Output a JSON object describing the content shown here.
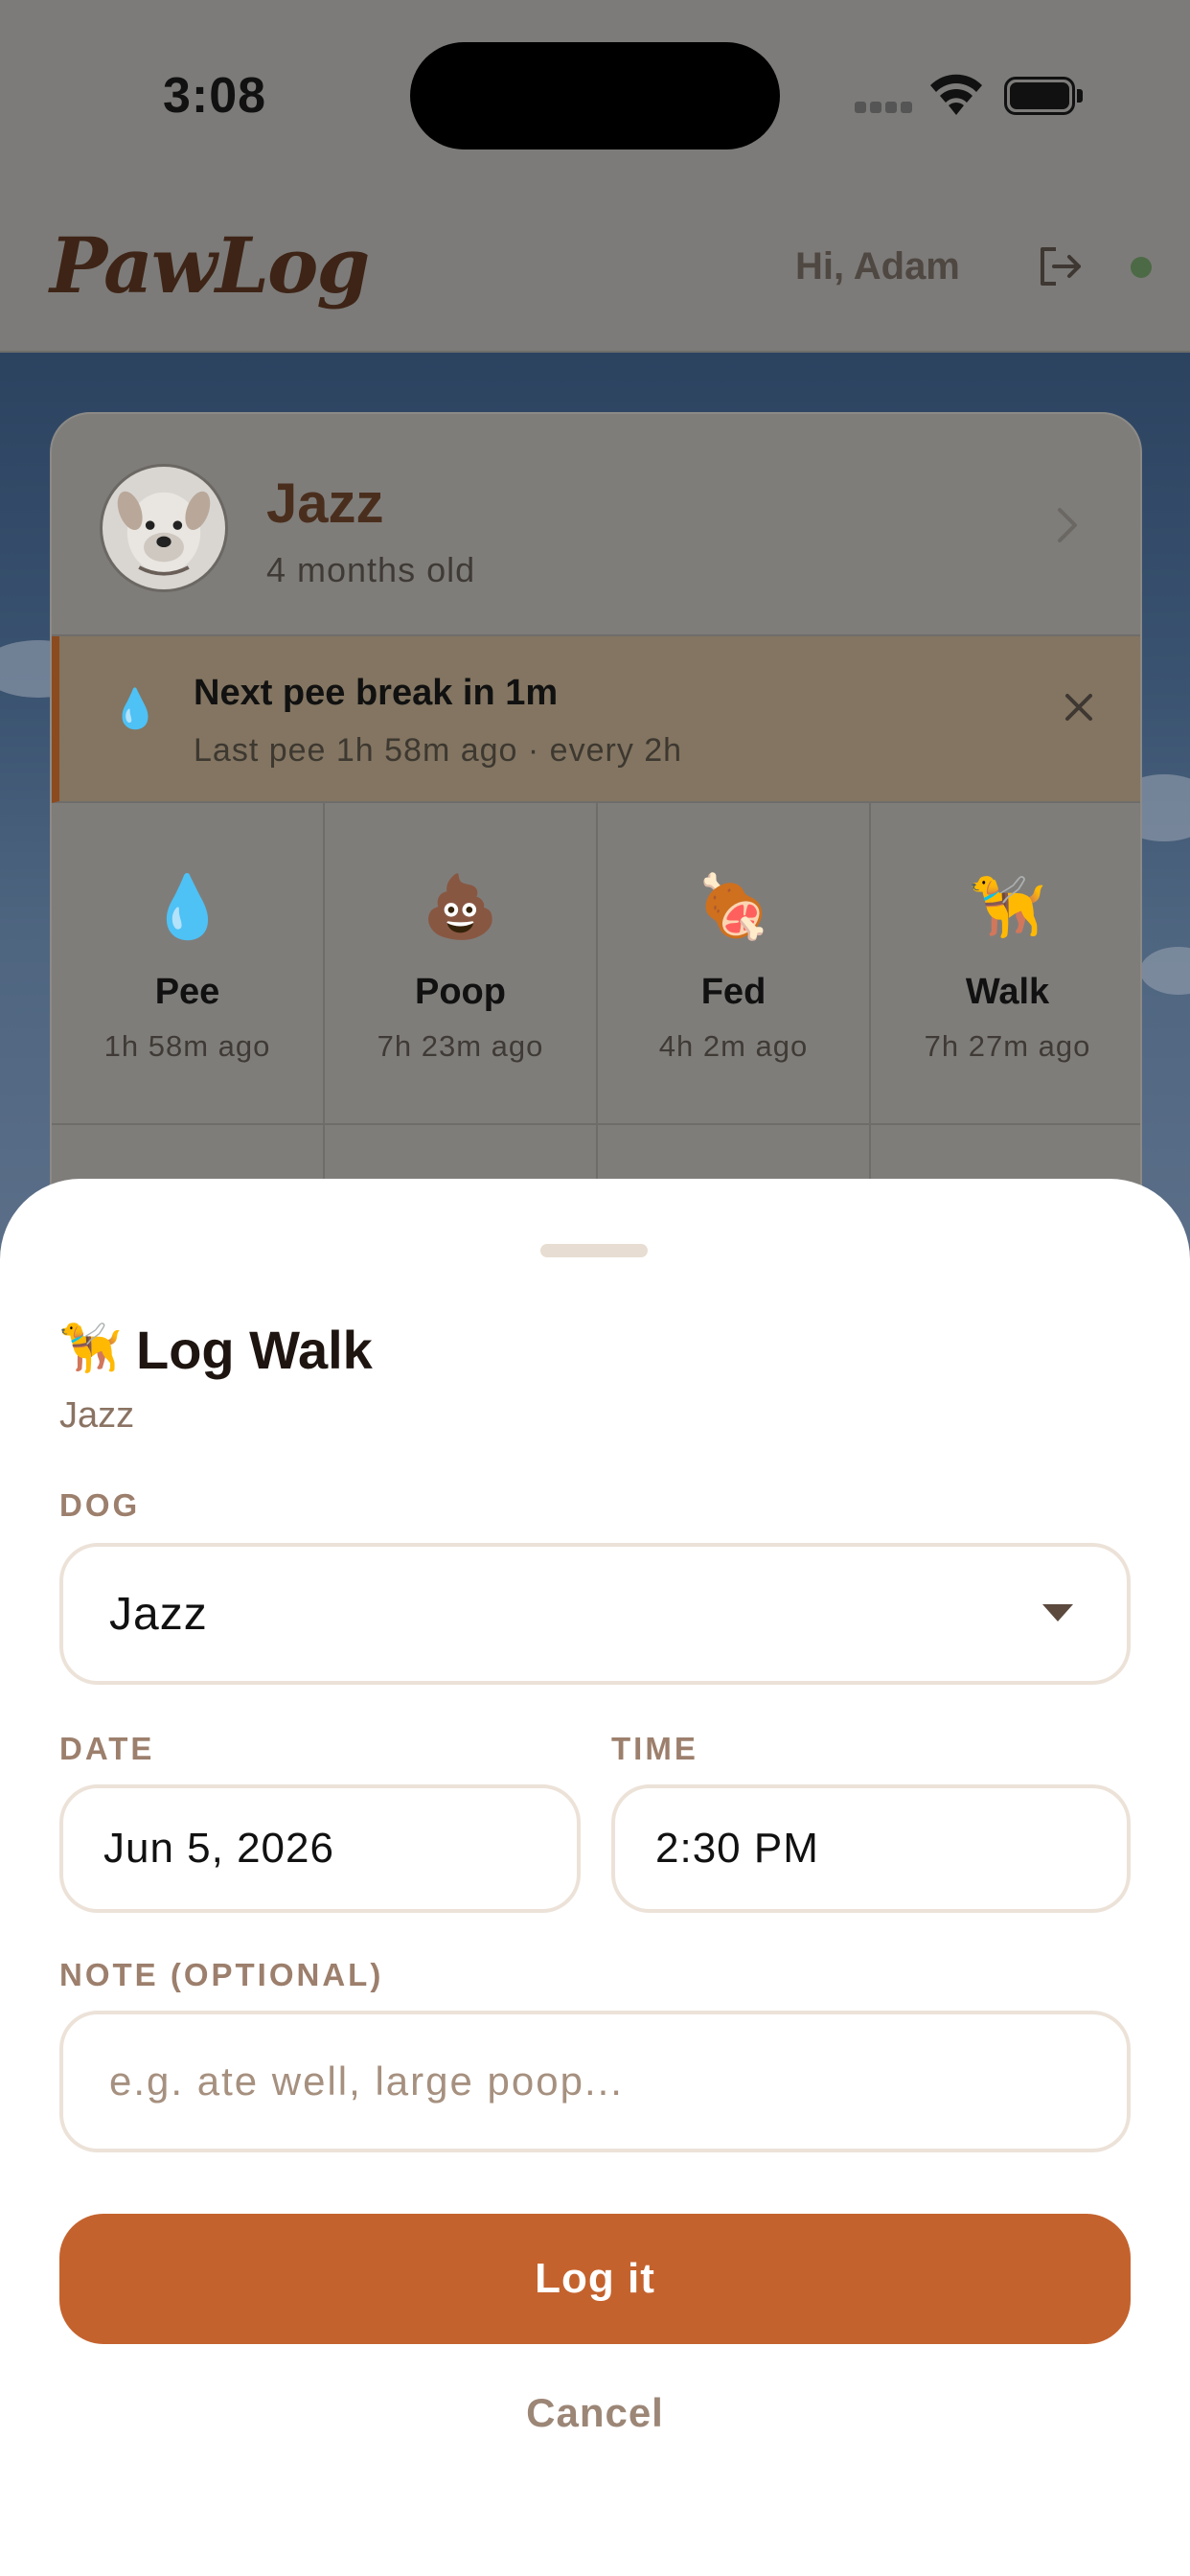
{
  "status_bar": {
    "time": "3:08"
  },
  "header": {
    "logo": "PawLog",
    "greeting": "Hi, Adam",
    "logout_icon": "logout-icon",
    "status_dot_color": "#4c6a45"
  },
  "dog": {
    "name": "Jazz",
    "age": "4 months old"
  },
  "alert": {
    "icon": "💧",
    "title": "Next pee break in 1m",
    "subtitle": "Last pee 1h 58m ago · every 2h"
  },
  "activities": [
    {
      "emoji": "💧",
      "label": "Pee",
      "ago": "1h 58m ago"
    },
    {
      "emoji": "💩",
      "label": "Poop",
      "ago": "7h 23m ago"
    },
    {
      "emoji": "🍖",
      "label": "Fed",
      "ago": "4h 2m ago"
    },
    {
      "emoji": "🦮",
      "label": "Walk",
      "ago": "7h 27m ago"
    }
  ],
  "sheet": {
    "emoji": "🦮",
    "title": "Log Walk",
    "subtitle": "Jazz",
    "dog_label": "DOG",
    "dog_value": "Jazz",
    "date_label": "DATE",
    "date_value": "Jun 5, 2026",
    "time_label": "TIME",
    "time_value": "2:30 PM",
    "note_label": "NOTE (OPTIONAL)",
    "note_value": "",
    "note_placeholder": "e.g. ate well, large poop...",
    "submit_label": "Log it",
    "cancel_label": "Cancel",
    "accent_color": "#c4622d"
  }
}
